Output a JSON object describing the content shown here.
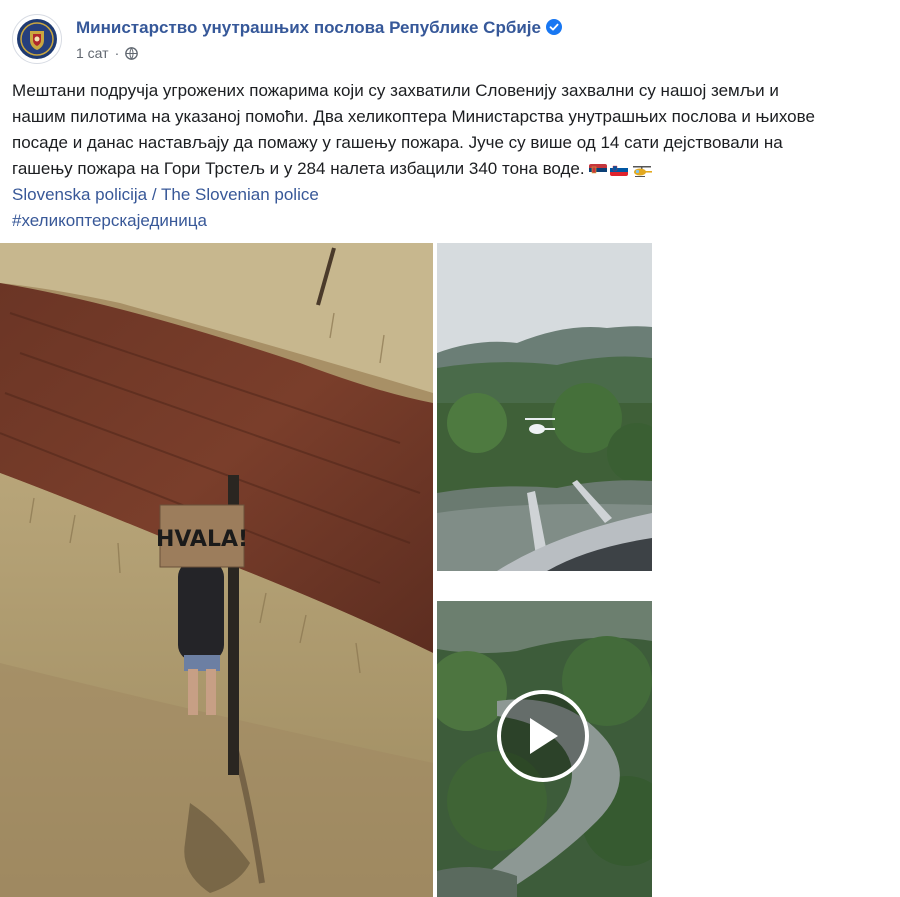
{
  "post": {
    "page_name": "Министарство унутрашњих послова Републике Србије",
    "time": "1 сат",
    "separator": "·",
    "text_line1": "Мештани подручја угрожених пожарима који су захватили Словенију захвални су нашој земљи и",
    "text_line2": "нашим пилотима на указаној помоћи. Два хеликоптера Министарства унутрашњих послова и њихове",
    "text_line3": "посаде и данас настављају да помажу у гашењу пожара. Јуче су више од 14 сати дејствовали на",
    "text_line4": "гашењу пожара на Гори Трстељ и у 284 налета избацили 340 тона воде.",
    "mention": "Slovenska policija / The Slovenian police",
    "hashtag": "#хеликоптерскајединица"
  },
  "photo": {
    "sign_text": "HVALA!"
  },
  "icons": {
    "verified": "verified-badge-icon",
    "globe": "globe-icon",
    "play": "play-icon",
    "flag1": "serbia-flag-icon",
    "flag2": "slovenia-flag-icon",
    "helicopter": "helicopter-icon"
  },
  "colors": {
    "link": "#385898",
    "page_name": "#365899",
    "verified": "#1877f2",
    "meta": "#616770"
  }
}
